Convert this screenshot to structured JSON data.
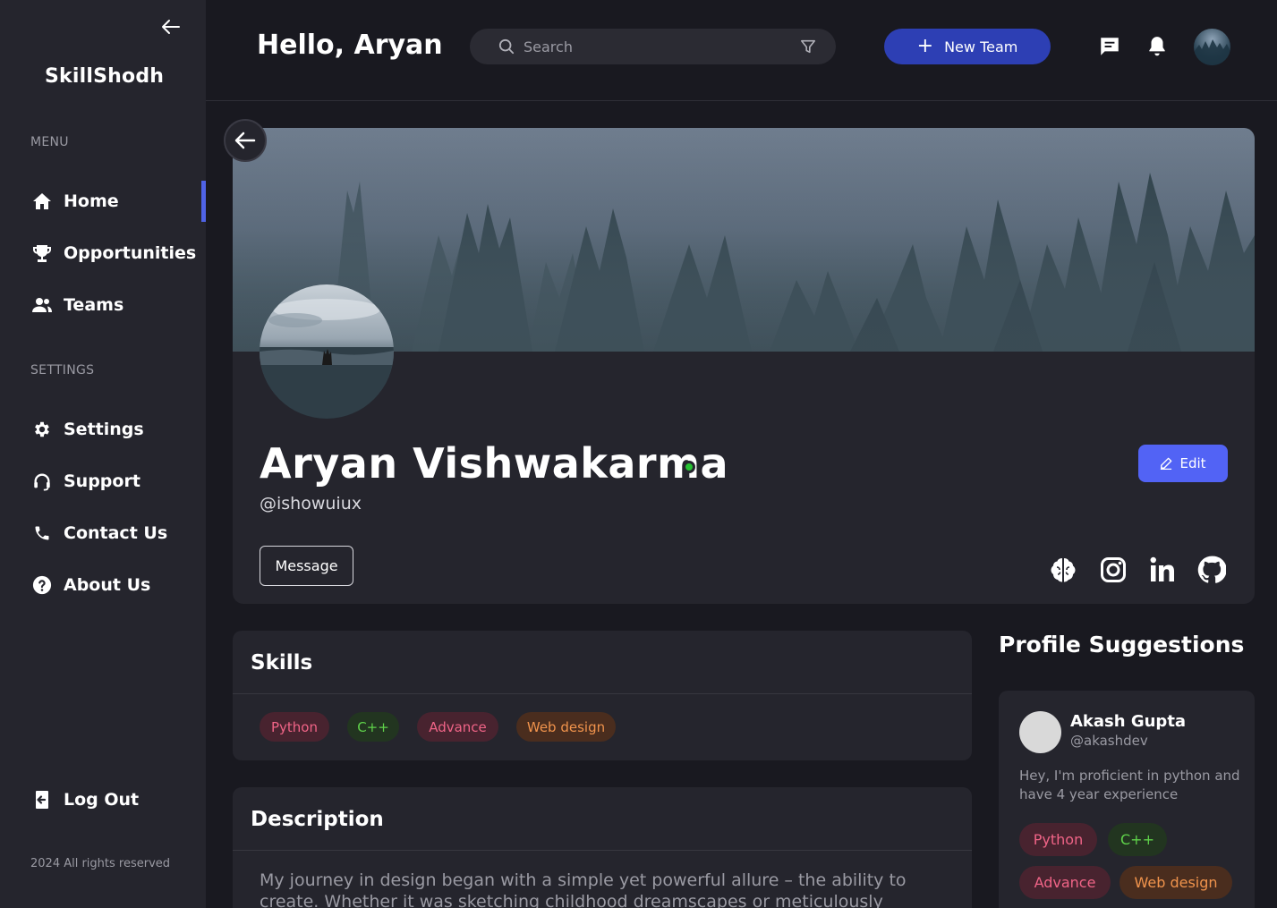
{
  "sidebar": {
    "brand": "SkillShodh",
    "menu_label": "MENU",
    "menu_items": [
      {
        "label": "Home",
        "icon": "home-icon",
        "active": true
      },
      {
        "label": "Opportunities",
        "icon": "trophy-icon"
      },
      {
        "label": "Teams",
        "icon": "users-icon"
      }
    ],
    "settings_label": "SETTINGS",
    "settings_items": [
      {
        "label": "Settings",
        "icon": "gear-icon"
      },
      {
        "label": "Support",
        "icon": "headset-icon"
      },
      {
        "label": "Contact Us",
        "icon": "phone-icon"
      },
      {
        "label": "About Us",
        "icon": "question-icon"
      }
    ],
    "logout_label": "Log Out",
    "footer": "2024 All rights reserved"
  },
  "header": {
    "greeting": "Hello, Aryan",
    "search_placeholder": "Search",
    "new_team_label": "New Team"
  },
  "profile": {
    "name": "Aryan Vishwakarma",
    "handle": "@ishowuiux",
    "online": true,
    "edit_label": "Edit",
    "message_label": "Message",
    "socials": [
      "brain-icon",
      "instagram-icon",
      "linkedin-icon",
      "github-icon"
    ]
  },
  "skills": {
    "title": "Skills",
    "items": [
      "Python",
      "C++",
      "Advance",
      "Web design"
    ]
  },
  "description": {
    "title": "Description",
    "text": "My journey in design began with a simple yet powerful allure – the ability to create. Whether it was sketching childhood dreamscapes or meticulously designing"
  },
  "suggestions": {
    "title": "Profile Suggestions",
    "items": [
      {
        "name": "Akash Gupta",
        "handle": "@akashdev",
        "bio": "Hey, I'm proficient in python and have 4 year experience",
        "skills": [
          "Python",
          "C++",
          "Advance",
          "Web design"
        ]
      }
    ]
  },
  "colors": {
    "accent": "#5263f5",
    "new_team_bg": "#2d3fb4",
    "online": "#26c232",
    "sidebar_bg": "#25252d",
    "page_bg": "#191920"
  }
}
